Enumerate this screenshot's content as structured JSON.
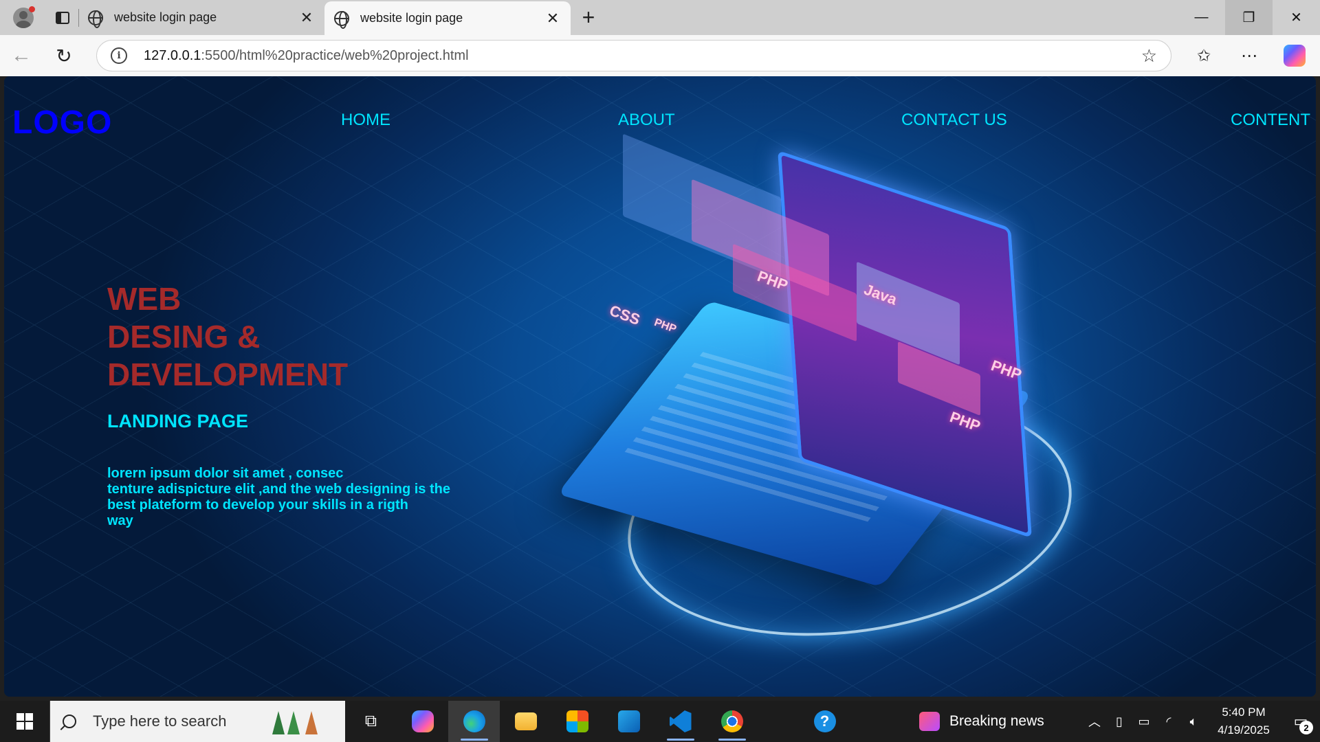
{
  "browser": {
    "tabs": [
      {
        "title": "website login page",
        "active": false
      },
      {
        "title": "website login page",
        "active": true
      }
    ],
    "new_tab_glyph": "+",
    "close_glyph": "✕",
    "window_controls": {
      "minimize": "—",
      "restore": "❐",
      "close": "✕"
    },
    "url_host": "127.0.0.1",
    "url_rest": ":5500/html%20practice/web%20project.html",
    "icons": [
      "profile-icon",
      "tab-actions-icon",
      "globe-icon",
      "back-icon",
      "reload-icon",
      "info-icon",
      "favorite-star-icon",
      "favorites-icon",
      "more-icon",
      "copilot-icon"
    ]
  },
  "site": {
    "logo": "LOGO",
    "nav": [
      "HOME",
      "ABOUT",
      "CONTACT US",
      "CONTENT"
    ],
    "hero_title_lines": [
      "WEB",
      "DESING &",
      "DEVELOPMENT"
    ],
    "hero_subtitle": "LANDING PAGE",
    "hero_text_lines": [
      "lorern ipsum dolor sit amet , consec",
      "tenture adispicture elit ,and the web designing is the",
      "best plateform to develop your skills in a rigth",
      "way"
    ],
    "illustration_tags": [
      "CSS",
      "PHP",
      "Java",
      "PHP",
      "PHP",
      "PHP"
    ],
    "colors": {
      "logo": "#0000ff",
      "nav": "#00e5ff",
      "title": "#a52a2a",
      "text": "#00e5ff"
    }
  },
  "taskbar": {
    "search_placeholder": "Type here to search",
    "apps": [
      "task-view",
      "copilot",
      "edge",
      "file-explorer",
      "microsoft-store",
      "outlook",
      "vscode",
      "chrome",
      "get-help"
    ],
    "news_label": "Breaking news",
    "time": "5:40 PM",
    "date": "4/19/2025",
    "notification_count": "2"
  }
}
